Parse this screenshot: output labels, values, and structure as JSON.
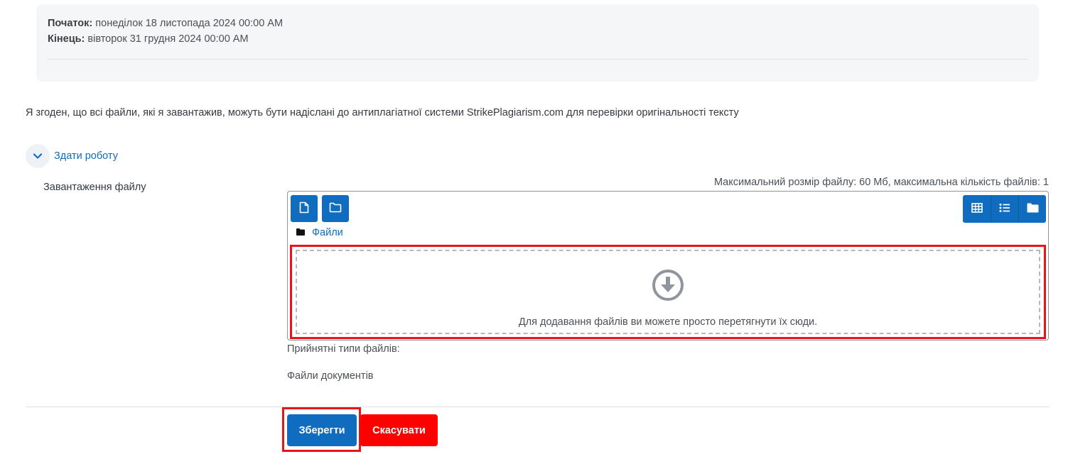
{
  "dates": {
    "start_label": "Початок:",
    "start_value": "понеділок 18 листопада 2024 00:00 AM",
    "end_label": "Кінець:",
    "end_value": "вівторок 31 грудня 2024 00:00 AM"
  },
  "agreement_text": "Я згоден, що всі файли, які я завантажив, можуть бути надіслані до антиплагіатної системи StrikePlagiarism.com для перевірки оригінальності тексту",
  "section": {
    "toggle_label": "Здати роботу",
    "toggle_icon": "chevron-down-icon"
  },
  "file_upload": {
    "label": "Завантаження файлу",
    "max_info": "Максимальний розмір файлу: 60 Мб, максимальна кількість файлів: 1",
    "path_label": "Файли",
    "dropzone_text": "Для додавання файлів ви можете просто перетягнути їх сюди.",
    "accepted_types_label": "Прийнятні типи файлів:",
    "accepted_types_value": "Файли документів",
    "icons": [
      "file-icon",
      "folder-icon",
      "grid-view-icon",
      "list-view-icon",
      "folder-view-icon",
      "download-circle-icon"
    ]
  },
  "buttons": {
    "save": "Зберегти",
    "cancel": "Скасувати"
  },
  "colors": {
    "primary": "#0f6cbf",
    "danger": "#ff0000",
    "highlight": "#e8141a"
  }
}
